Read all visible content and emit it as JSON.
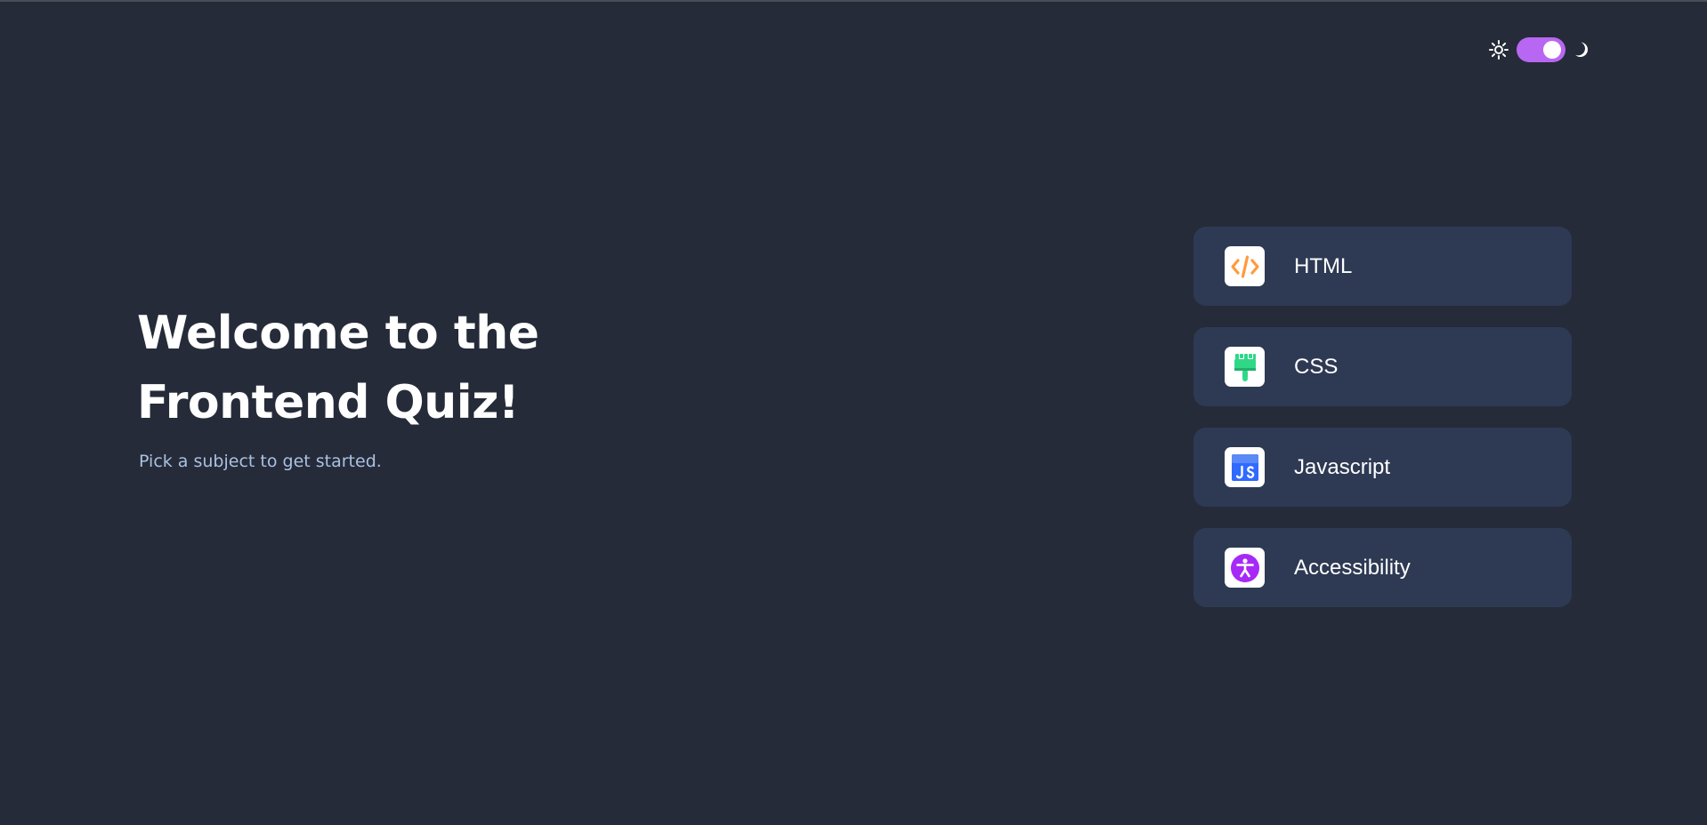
{
  "theme": {
    "mode": "dark",
    "accent": "#b867f2",
    "light_icon": "sun-icon",
    "dark_icon": "moon-icon"
  },
  "hero": {
    "title_line1": "Welcome to the",
    "title_line2": "Frontend Quiz!",
    "subtitle": "Pick a subject to get started."
  },
  "subjects": [
    {
      "label": "HTML",
      "icon": "html-code-icon",
      "color": "#ff9a3c"
    },
    {
      "label": "CSS",
      "icon": "css-paintbrush-icon",
      "color": "#2fd887"
    },
    {
      "label": "Javascript",
      "icon": "javascript-icon",
      "color": "#306aff"
    },
    {
      "label": "Accessibility",
      "icon": "accessibility-icon",
      "color": "#a729f5"
    }
  ]
}
